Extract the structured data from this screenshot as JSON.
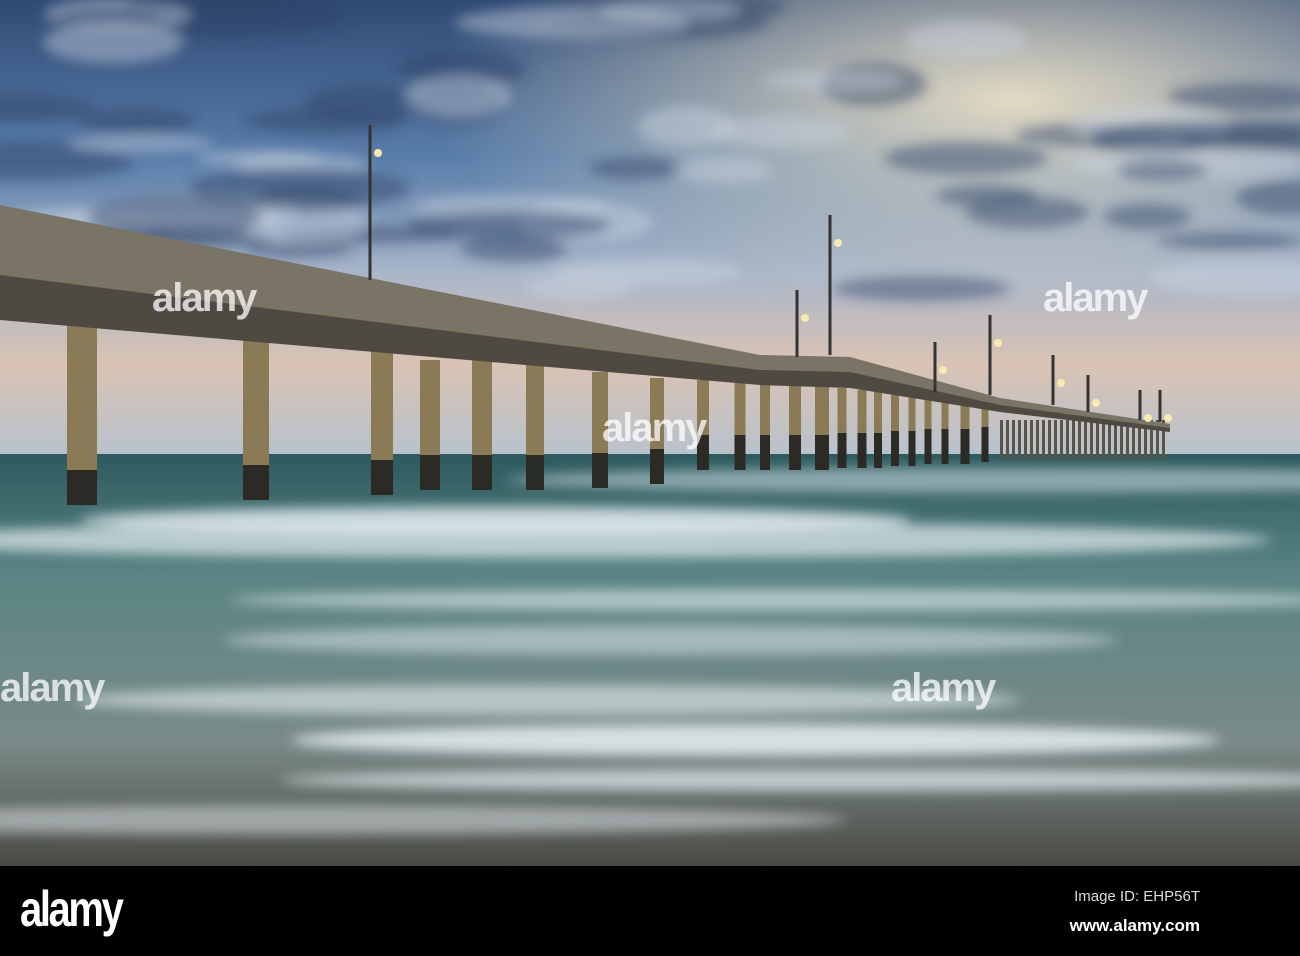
{
  "photo": {
    "subject": "pier-at-sunset-with-waves"
  },
  "watermark": {
    "text": "alamy"
  },
  "footer": {
    "logo": "alamy",
    "image_id": "Image ID: EHP56T",
    "url": "www.alamy.com"
  },
  "colors": {
    "sky_top": "#3a5a86",
    "sky_glow": "#e8d6b8",
    "sea": "#3f6a6a",
    "foam": "#e6eef2",
    "bar": "#000000"
  }
}
